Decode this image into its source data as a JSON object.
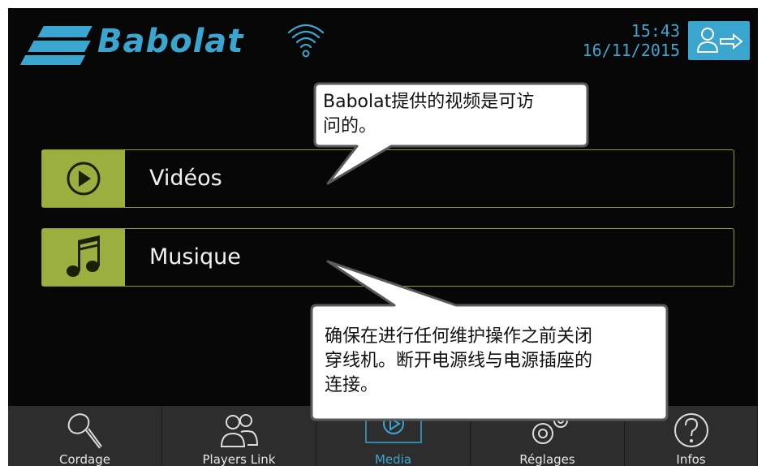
{
  "header": {
    "brand": "Babolat",
    "time": "15:43",
    "date": "16/11/2015",
    "icons": [
      "wifi-icon",
      "logout-icon"
    ]
  },
  "menu": [
    {
      "label": "Vidéos",
      "icon": "play-icon"
    },
    {
      "label": "Musique",
      "icon": "music-note-icon"
    }
  ],
  "tabs": [
    {
      "label": "Cordage",
      "icon": "racket-icon",
      "active": false
    },
    {
      "label": "Players Link",
      "icon": "players-icon",
      "active": false
    },
    {
      "label": "Media",
      "icon": "play-icon",
      "active": true
    },
    {
      "label": "Réglages",
      "icon": "gears-icon",
      "active": false
    },
    {
      "label": "Infos",
      "icon": "question-icon",
      "active": false
    }
  ],
  "callouts": {
    "top": [
      "Babolat提供的视频是可访",
      "问的。"
    ],
    "bottom": [
      "确保在进行任何维护操作之前关闭",
      "穿线机。断开电源线与电源插座的",
      "连接。"
    ]
  },
  "colors": {
    "accent_blue": "#3aa6d0",
    "accent_green": "#9aaf3e",
    "background": "#070707",
    "tab_bar": "#2d2d2d"
  }
}
